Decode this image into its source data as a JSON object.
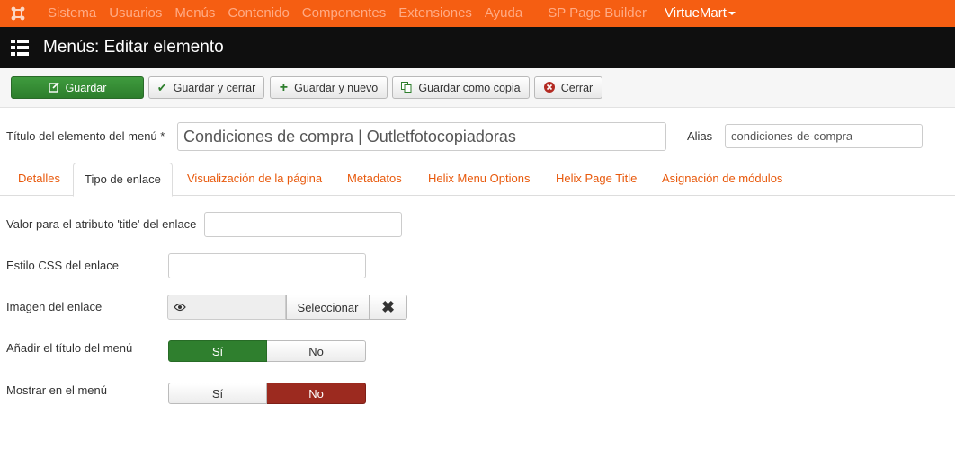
{
  "topnav": {
    "items": [
      "Sistema",
      "Usuarios",
      "Menús",
      "Contenido",
      "Componentes",
      "Extensiones",
      "Ayuda",
      "SP Page Builder",
      "VirtueMart"
    ]
  },
  "titlebar": {
    "title": "Menús: Editar elemento"
  },
  "toolbar": {
    "save": "Guardar",
    "save_close": "Guardar y cerrar",
    "save_new": "Guardar y nuevo",
    "save_copy": "Guardar como copia",
    "close": "Cerrar"
  },
  "form": {
    "title_label": "Título del elemento del menú *",
    "title_value": "Condiciones de compra | Outletfotocopiadoras",
    "alias_label": "Alias",
    "alias_value": "condiciones-de-compra"
  },
  "tabs": [
    "Detalles",
    "Tipo de enlace",
    "Visualización de la página",
    "Metadatos",
    "Helix Menu Options",
    "Helix Page Title",
    "Asignación de módulos"
  ],
  "active_tab": "Tipo de enlace",
  "fields": {
    "link_title_label": "Valor para el atributo 'title' del enlace",
    "link_title_value": "",
    "css_label": "Estilo CSS del enlace",
    "css_value": "",
    "image_label": "Imagen del enlace",
    "image_select": "Seleccionar",
    "add_title_label": "Añadir el título del menú",
    "add_title_yes": "Sí",
    "add_title_no": "No",
    "add_title_selected": "Sí",
    "display_label": "Mostrar en el menú",
    "display_yes": "Sí",
    "display_no": "No",
    "display_selected": "No"
  },
  "colors": {
    "nav_bg": "#f55e12",
    "titlebar_bg": "#0f0f0f",
    "save_green": "#2d7e2c",
    "toggle_green": "#2f7f2e",
    "toggle_red": "#9c2a1f",
    "tab_link": "#e8590c"
  },
  "icons": {
    "logo": "joomla-logo-icon",
    "titlebar": "list-icon",
    "save": "edit-icon",
    "save_close": "checkmark-icon",
    "save_new": "plus-icon",
    "save_copy": "copy-icon",
    "close": "cancel-circle-icon",
    "preview": "eye-icon",
    "clear": "close-icon"
  }
}
